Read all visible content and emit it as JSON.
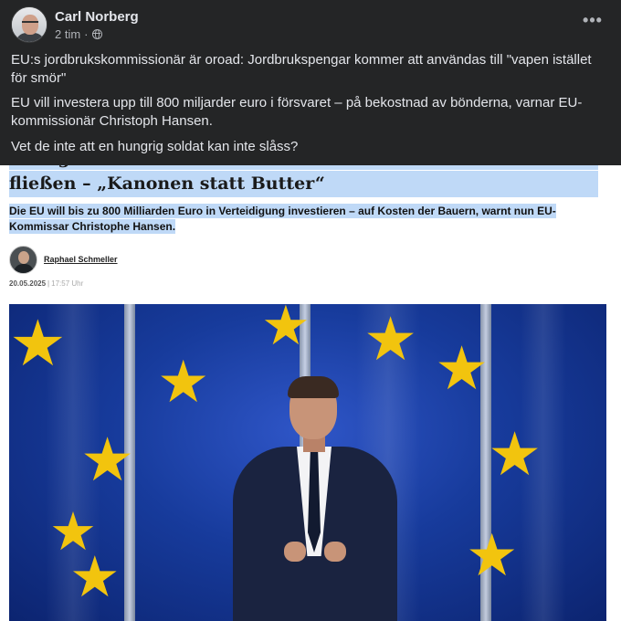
{
  "post": {
    "author": "Carl Norberg",
    "time": "2 tim",
    "meta_separator": "·",
    "audience_icon": "globe-icon",
    "more_icon": "more-options-icon",
    "paragraphs": [
      "EU:s jordbrukskommissionär är oroad: Jordbrukspengar kommer att användas till \"vapen istället för smör\"",
      "EU vill investera upp till 800 miljarder euro i försvaret – på bekostnad av bönderna, varnar EU-kommissionär Christoph Hansen.",
      "Vet de inte att en hungrig soldat  kan inte slåss?"
    ]
  },
  "article": {
    "headline_partial": "EU-Agrarkommissar warnt: Geld der Landwirtschaft soll in Rüstung",
    "headline": "fließen – „Kanonen statt Butter“",
    "subheadline": "Die EU will bis zu 800 Milliarden Euro in Verteidigung investieren – auf Kosten der Bauern, warnt nun EU-Kommissar Christophe Hansen.",
    "author_name": "Raphael Schmeller",
    "date": "20.05.2025",
    "date_separator": "|",
    "time": "17:57 Uhr"
  },
  "colors": {
    "post_background": "#242526",
    "post_text": "#e4e6eb",
    "post_secondary": "#b0b3b8",
    "highlight": "#bfd9f7",
    "flag_blue": "#173b9c",
    "star_gold": "#f2c40e"
  }
}
